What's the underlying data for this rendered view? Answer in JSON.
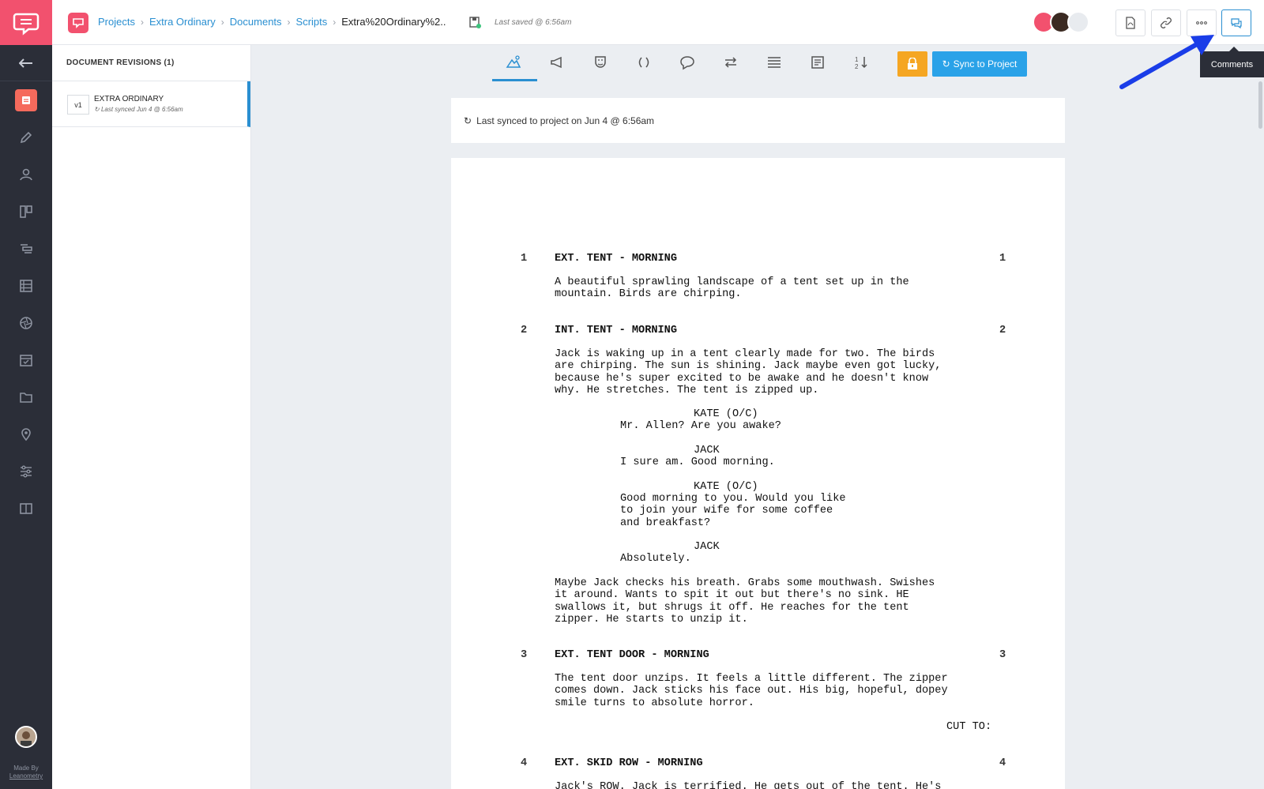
{
  "breadcrumb": {
    "items": [
      "Projects",
      "Extra Ordinary",
      "Documents",
      "Scripts"
    ],
    "current": "Extra%20Ordinary%2..",
    "last_saved": "Last saved @ 6:56am"
  },
  "top_actions": {
    "tooltip": "Comments"
  },
  "revisions": {
    "header": "DOCUMENT REVISIONS (1)",
    "items": [
      {
        "tag": "v1",
        "title": "EXTRA ORDINARY",
        "subtitle": "Last synced Jun 4 @ 6:56am"
      }
    ]
  },
  "toolbar": {
    "sync_label": "Sync to Project"
  },
  "sync_banner": "Last synced to project on Jun 4 @ 6:56am",
  "rail": {
    "made_by": "Made By",
    "made_by_link": "Leanometry"
  },
  "colors": {
    "brand": "#f2516e",
    "accent": "#2a8fd1",
    "sync_button": "#2aa2e8",
    "lock_button": "#f5a623",
    "rail": "#2b2e38"
  },
  "script": {
    "scenes": [
      {
        "number": "1",
        "heading": "EXT. TENT - MORNING"
      },
      {
        "number": "2",
        "heading": "INT. TENT - MORNING"
      },
      {
        "number": "3",
        "heading": "EXT. TENT DOOR - MORNING"
      },
      {
        "number": "4",
        "heading": "EXT. SKID ROW - MORNING"
      }
    ],
    "action_1": "A beautiful sprawling landscape of a tent set up in the\nmountain. Birds are chirping.",
    "action_2": "Jack is waking up in a tent clearly made for two. The birds\nare chirping. The sun is shining. Jack maybe even got lucky,\nbecause he's super excited to be awake and he doesn't know\nwhy. He stretches. The tent is zipped up.",
    "char_1": "KATE (O/C)",
    "dial_1": "Mr. Allen? Are you awake?",
    "char_2": "JACK",
    "dial_2": "I sure am. Good morning.",
    "char_3": "KATE (O/C)",
    "dial_3": "Good morning to you. Would you like\nto join your wife for some coffee\nand breakfast?",
    "char_4": "JACK",
    "dial_4": "Absolutely.",
    "action_3": "Maybe Jack checks his breath. Grabs some mouthwash. Swishes\nit around. Wants to spit it out but there's no sink. HE\nswallows it, but shrugs it off. He reaches for the tent\nzipper. He starts to unzip it.",
    "action_4": "The tent door unzips. It feels a little different. The zipper\ncomes down. Jack sticks his face out. His big, hopeful, dopey\nsmile turns to absolute horror.",
    "transition": "CUT TO:",
    "action_5": "Jack's ROW. Jack is terrified. He gets out of the tent. He's"
  }
}
